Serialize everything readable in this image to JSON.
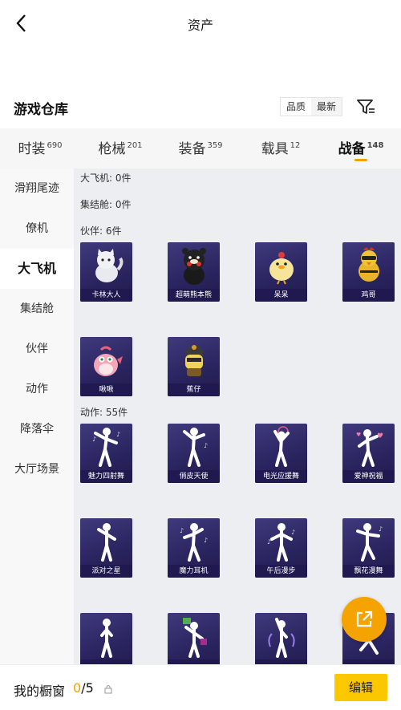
{
  "header": {
    "title": "资产",
    "back_icon": "chevron-left-icon"
  },
  "warehouse": {
    "title": "游戏仓库",
    "sort_options": [
      "品质",
      "最新"
    ],
    "filter_icon": "filter-settings-icon"
  },
  "tabs": [
    {
      "label": "时装",
      "count": "690"
    },
    {
      "label": "枪械",
      "count": "201"
    },
    {
      "label": "装备",
      "count": "359"
    },
    {
      "label": "载具",
      "count": "12"
    },
    {
      "label": "战备",
      "count": "148",
      "active": true
    }
  ],
  "sidebar": {
    "items": [
      "滑翔尾迹",
      "僚机",
      "大飞机",
      "集结舱",
      "伙伴",
      "动作",
      "降落伞",
      "大厅场景"
    ],
    "active_index": 2
  },
  "sections": {
    "plane": "大飞机: 0件",
    "cabin": "集结舱: 0件",
    "partner": "伙伴: 6件",
    "action": "动作: 55件"
  },
  "partners": [
    "卡林大人",
    "超萌熊本熊",
    "呆呆",
    "鸡哥",
    "啾啾",
    "蕉仔"
  ],
  "actions": [
    "魅力四射舞",
    "俏皮天使",
    "电光应援舞",
    "爱神祝福",
    "派对之星",
    "魔力耳机",
    "午后漫步",
    "飘花漫舞",
    "",
    "",
    "",
    ""
  ],
  "bottom": {
    "label": "我的橱窗",
    "current": "0",
    "total": "/5",
    "edit": "编辑"
  },
  "colors": {
    "accent": "#f4a000",
    "edit_button": "#fbc800",
    "card_bg": "#2b2561"
  }
}
